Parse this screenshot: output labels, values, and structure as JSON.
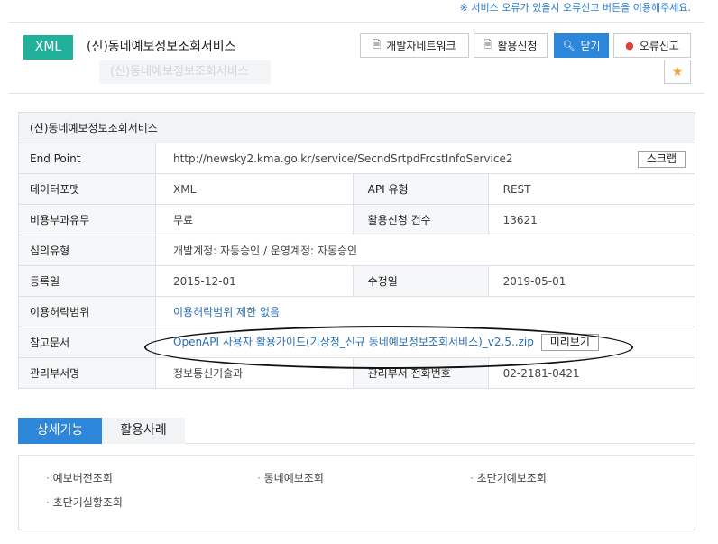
{
  "notice": "※ 서비스 오류가 있을시 오류신고 버튼을 이용해주세요.",
  "header": {
    "badge": "XML",
    "title": "(신)동네예보정보조회서비스",
    "ghost_title": "(신)동네예보정보조회서비스",
    "buttons": {
      "devnet": "개발자네트워크",
      "apply": "활용신청",
      "close": "닫기",
      "report": "오류신고"
    }
  },
  "table": {
    "caption": "(신)동네예보정보조회서비스",
    "endpoint_label": "End Point",
    "endpoint_value": "http://newsky2.kma.go.kr/service/SecndSrtpdFrcstInfoService2",
    "scrap_button": "스크랩",
    "data_format_label": "데이터포맷",
    "data_format_value": "XML",
    "api_type_label": "API 유형",
    "api_type_value": "REST",
    "fee_label": "비용부과유무",
    "fee_value": "무료",
    "apply_count_label": "활용신청 건수",
    "apply_count_value": "13621",
    "review_label": "심의유형",
    "review_value": "개발계정: 자동승인 / 운영계정: 자동승인",
    "reg_date_label": "등록일",
    "reg_date_value": "2015-12-01",
    "mod_date_label": "수정일",
    "mod_date_value": "2019-05-01",
    "license_label": "이용허락범위",
    "license_value": "이용허락범위 제한 없음",
    "ref_doc_label": "참고문서",
    "ref_doc_value": "OpenAPI 사용자 활용가이드(기상청_신규 동네예보정보조회서비스)_v2.5..zip",
    "preview_button": "미리보기",
    "dept_label": "관리부서명",
    "dept_value": "정보통신기술과",
    "dept_phone_label": "관리부서 전화번호",
    "dept_phone_value": "02-2181-0421"
  },
  "tabs": {
    "detail": "상세기능",
    "cases": "활용사례"
  },
  "features": [
    "예보버전조회",
    "동네예보조회",
    "초단기예보조회",
    "초단기실황조회"
  ],
  "colors": {
    "accent": "#2c86d9",
    "badge": "#21b19b",
    "report_icon": "#e0403a",
    "star": "#f0a22e"
  },
  "icons": {
    "devnet": "document-icon",
    "apply": "document-icon",
    "close": "search-icon",
    "report": "exclamation-icon",
    "favorite": "star-icon"
  }
}
